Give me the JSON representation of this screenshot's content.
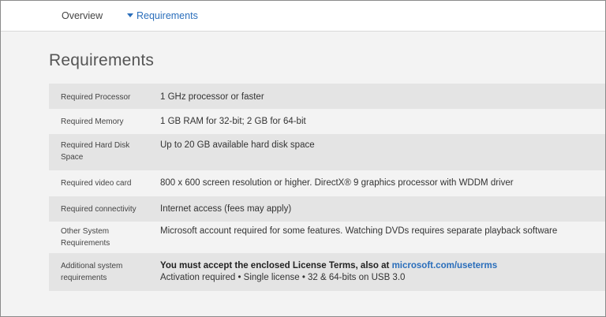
{
  "tabs": {
    "overview": "Overview",
    "requirements": "Requirements"
  },
  "page_title": "Requirements",
  "requirements": [
    {
      "label": "Required Processor",
      "value": "1 GHz processor or faster"
    },
    {
      "label": "Required Memory",
      "value": "1 GB RAM for 32-bit; 2 GB for 64-bit"
    },
    {
      "label": "Required Hard Disk Space",
      "value": "Up to 20 GB available hard disk space"
    },
    {
      "label": "Required video card",
      "value": "800 x 600 screen resolution or higher. DirectX® 9 graphics processor with WDDM driver"
    },
    {
      "label": "Required connectivity",
      "value": "Internet access (fees may apply)"
    },
    {
      "label": "Other System Requirements",
      "value": "Microsoft account required for some features. Watching DVDs requires separate playback software"
    },
    {
      "label": "Additional system requirements",
      "value_bold": "You must accept the enclosed License Terms, also at",
      "link": "microsoft.com/useterms",
      "value_line2": "Activation required • Single license • 32 & 64-bits on USB 3.0"
    }
  ],
  "colors": {
    "link": "#2a6ebb",
    "row_shade": "#e4e4e4",
    "background": "#f3f3f3"
  },
  "icons": {
    "requirements_tab": "caret-down-icon"
  }
}
